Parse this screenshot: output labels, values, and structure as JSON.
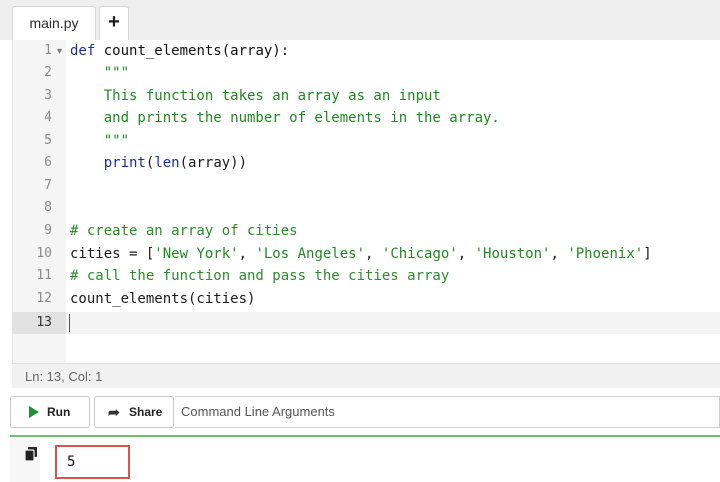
{
  "tabs": [
    {
      "label": "main.py",
      "active": true
    }
  ],
  "add_tab_label": "+",
  "editor": {
    "line_numbers": [
      "1",
      "2",
      "3",
      "4",
      "5",
      "6",
      "7",
      "8",
      "9",
      "10",
      "11",
      "12",
      "13"
    ],
    "active_line": "13",
    "lines": {
      "l1_kw": "def",
      "l1_rest": " count_elements(array):",
      "l2": "    \"\"\"",
      "l3": "    This function takes an array as an input",
      "l4": "    and prints the number of elements in the array.",
      "l5": "    \"\"\"",
      "l6_indent": "    ",
      "l6_print": "print",
      "l6_open": "(",
      "l6_len": "len",
      "l6_rest": "(array))",
      "l8": "# create an array of cities",
      "l9_head": "cities = [",
      "l9_s1": "'New York'",
      "l9_s2": "'Los Angeles'",
      "l9_s3": "'Chicago'",
      "l9_s4": "'Houston'",
      "l9_s5": "'Phoenix'",
      "l9_sep": ", ",
      "l9_tail": "]",
      "l11": "# call the function and pass the cities array",
      "l12": "count_elements(cities)"
    }
  },
  "status": "Ln: 13,  Col: 1",
  "toolbar": {
    "run_label": "Run",
    "share_label": "Share",
    "args_placeholder": "Command Line Arguments"
  },
  "console": {
    "output": "5"
  },
  "colors": {
    "run_green": "#1e8f3a",
    "highlight_red": "#d9534f",
    "console_border": "#6dbf73"
  },
  "icons": [
    "play-icon",
    "share-icon",
    "copy-icon",
    "fold-arrow-icon"
  ]
}
